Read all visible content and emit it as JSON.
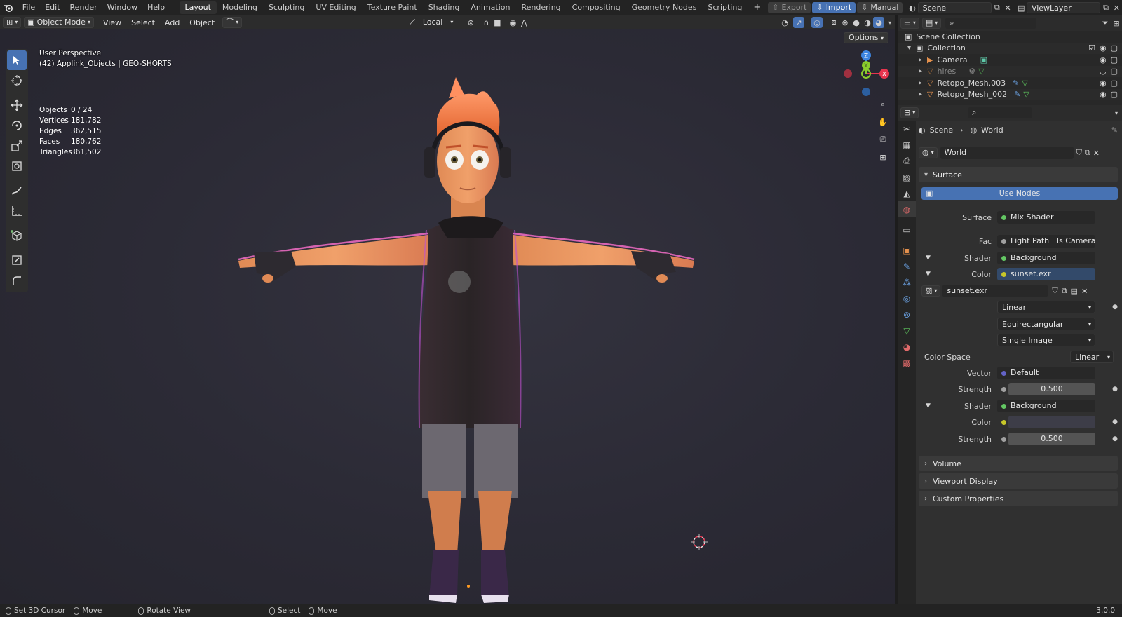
{
  "topbar": {
    "menus": [
      "File",
      "Edit",
      "Render",
      "Window",
      "Help"
    ],
    "workspaces": [
      "Layout",
      "Modeling",
      "Sculpting",
      "UV Editing",
      "Texture Paint",
      "Shading",
      "Animation",
      "Rendering",
      "Compositing",
      "Geometry Nodes",
      "Scripting"
    ],
    "active_workspace": "Layout",
    "add_workspace": "+",
    "export_label": "Export",
    "import_label": "Import",
    "manual_label": "Manual",
    "scene_name": "Scene",
    "view_layer": "ViewLayer"
  },
  "viewport_header": {
    "mode": "Object Mode",
    "menus": [
      "View",
      "Select",
      "Add",
      "Object"
    ],
    "transform_orientation": "Local",
    "options_label": "Options"
  },
  "viewport": {
    "view_name": "User Perspective",
    "collection_info": "(42) Applink_Objects | GEO-SHORTS",
    "stats": [
      {
        "label": "Objects",
        "value": "0 / 24"
      },
      {
        "label": "Vertices",
        "value": "181,782"
      },
      {
        "label": "Edges",
        "value": "362,515"
      },
      {
        "label": "Faces",
        "value": "180,762"
      },
      {
        "label": "Triangles",
        "value": "361,502"
      }
    ],
    "gizmo_z": "Z",
    "gizmo_y": "Y",
    "gizmo_x": "X"
  },
  "outliner": {
    "root": "Scene Collection",
    "collection": "Collection",
    "items": [
      {
        "name": "Camera"
      },
      {
        "name": "hires"
      },
      {
        "name": "Retopo_Mesh.003"
      },
      {
        "name": "Retopo_Mesh_002"
      }
    ]
  },
  "properties": {
    "breadcrumb_scene": "Scene",
    "breadcrumb_world": "World",
    "world_name": "World",
    "surface_panel": "Surface",
    "use_nodes": "Use Nodes",
    "surface_label": "Surface",
    "surface_value": "Mix Shader",
    "fac_label": "Fac",
    "fac_value": "Light Path | Is Camera Ray",
    "shader1_label": "Shader",
    "shader1_value": "Background",
    "color1_label": "Color",
    "color1_value": "sunset.exr",
    "image_name": "sunset.exr",
    "interpolation": "Linear",
    "projection": "Equirectangular",
    "source": "Single Image",
    "color_space_label": "Color Space",
    "color_space_value": "Linear",
    "vector_label": "Vector",
    "vector_value": "Default",
    "strength1_label": "Strength",
    "strength1_value": "0.500",
    "shader2_label": "Shader",
    "shader2_value": "Background",
    "color2_label": "Color",
    "strength2_label": "Strength",
    "strength2_value": "0.500",
    "volume_panel": "Volume",
    "viewport_display_panel": "Viewport Display",
    "custom_props_panel": "Custom Properties"
  },
  "statusbar": {
    "set_cursor": "Set 3D Cursor",
    "move1": "Move",
    "rotate_view": "Rotate View",
    "select": "Select",
    "move2": "Move",
    "version": "3.0.0"
  },
  "colors": {
    "accent": "#4772b3",
    "socket_green": "#63c763",
    "socket_yellow": "#c7c729",
    "socket_grey": "#a1a1a1",
    "socket_purple": "#6363c7",
    "gizmo_x": "#e8344e",
    "gizmo_y": "#8acc2c",
    "gizmo_z": "#3d85e0"
  }
}
